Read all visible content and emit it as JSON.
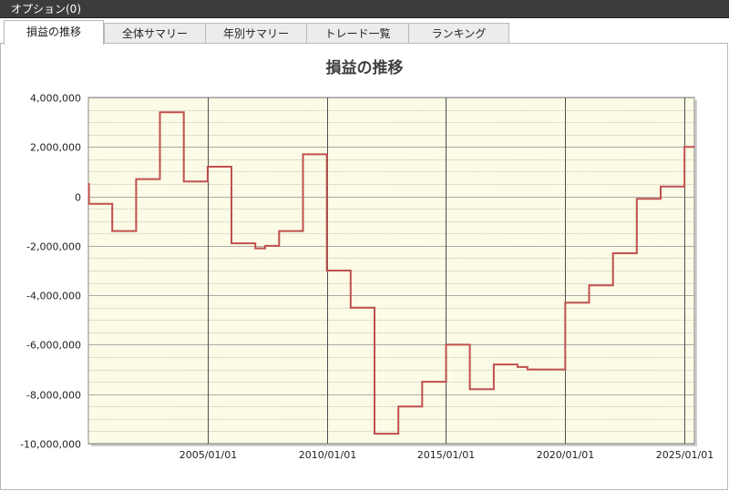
{
  "window": {
    "title": "オプション(0)"
  },
  "tabs": [
    {
      "label": "損益の推移",
      "active": true
    },
    {
      "label": "全体サマリー",
      "active": false
    },
    {
      "label": "年別サマリー",
      "active": false
    },
    {
      "label": "トレード一覧",
      "active": false
    },
    {
      "label": "ランキング",
      "active": false
    }
  ],
  "colors": {
    "line": "#c0504d",
    "plot_bg": "#fbfbe6",
    "grid_major": "#505050",
    "grid_minor": "#a8a8a8"
  },
  "chart_data": {
    "type": "line",
    "title": "損益の推移",
    "xlabel": "",
    "ylabel": "",
    "xlim": [
      "2000/01/01",
      "2025/06/01"
    ],
    "ylim": [
      -10000000,
      4000000
    ],
    "x_ticks": [
      "2005/01/01",
      "2010/01/01",
      "2015/01/01",
      "2020/01/01",
      "2025/01/01"
    ],
    "y_ticks": [
      "4,000,000",
      "2,000,000",
      "0",
      "-2,000,000",
      "-4,000,000",
      "-6,000,000",
      "-8,000,000",
      "-10,000,000"
    ],
    "grid": true,
    "series": [
      {
        "x": [
          "2000/01/01",
          "2000/01/10",
          "2001/01/01",
          "2002/01/01",
          "2003/01/01",
          "2004/01/01",
          "2005/01/01",
          "2006/01/01",
          "2007/01/01",
          "2007/06/01",
          "2008/01/01",
          "2009/01/01",
          "2010/01/01",
          "2011/01/01",
          "2012/01/01",
          "2013/01/01",
          "2014/01/01",
          "2015/01/01",
          "2016/01/01",
          "2017/01/01",
          "2018/01/01",
          "2018/06/01",
          "2019/01/01",
          "2020/01/01",
          "2021/01/01",
          "2022/01/01",
          "2023/01/01",
          "2024/01/01",
          "2025/01/01",
          "2025/06/01"
        ],
        "y": [
          500000,
          -300000,
          -1400000,
          700000,
          3400000,
          600000,
          1200000,
          -1900000,
          -2100000,
          -2000000,
          -1400000,
          1700000,
          -3000000,
          -4500000,
          -9600000,
          -8500000,
          -7500000,
          -6000000,
          -7800000,
          -6800000,
          -6900000,
          -7000000,
          -7000000,
          -4300000,
          -3600000,
          -2300000,
          -100000,
          400000,
          2000000,
          2000000
        ]
      }
    ]
  }
}
